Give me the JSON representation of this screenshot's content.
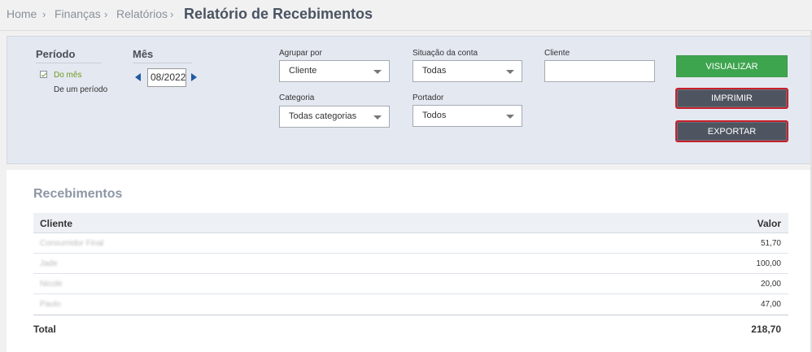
{
  "breadcrumb": {
    "items": [
      "Home",
      "Finanças",
      "Relatórios"
    ],
    "separator": "›",
    "current": "Relatório de Recebimentos"
  },
  "filters": {
    "periodo": {
      "heading": "Período",
      "options": [
        "Do mês",
        "De um período"
      ],
      "selected": "Do mês"
    },
    "mes": {
      "heading": "Mês",
      "value": "08/2022"
    },
    "agrupar_por": {
      "label": "Agrupar por",
      "value": "Cliente"
    },
    "situacao_conta": {
      "label": "Situação da conta",
      "value": "Todas"
    },
    "cliente": {
      "label": "Cliente",
      "value": ""
    },
    "categoria": {
      "label": "Categoria",
      "value": "Todas categorias"
    },
    "portador": {
      "label": "Portador",
      "value": "Todos"
    }
  },
  "buttons": {
    "visualizar": "VISUALIZAR",
    "imprimir": "IMPRIMIR",
    "exportar": "EXPORTAR"
  },
  "report": {
    "title": "Recebimentos",
    "columns": [
      "Cliente",
      "Valor"
    ],
    "rows": [
      {
        "cliente": "Consumidor Final",
        "valor": "51,70"
      },
      {
        "cliente": "Jade",
        "valor": "100,00"
      },
      {
        "cliente": "Nicole",
        "valor": "20,00"
      },
      {
        "cliente": "Paulo",
        "valor": "47,00"
      }
    ],
    "total_label": "Total",
    "total_value": "218,70"
  },
  "colors": {
    "accent_green": "#3ea54f",
    "button_dark": "#4e5560",
    "highlight_red": "#c8202a",
    "filter_bg": "#e4e8f1",
    "active_option": "#6e9a1e"
  }
}
